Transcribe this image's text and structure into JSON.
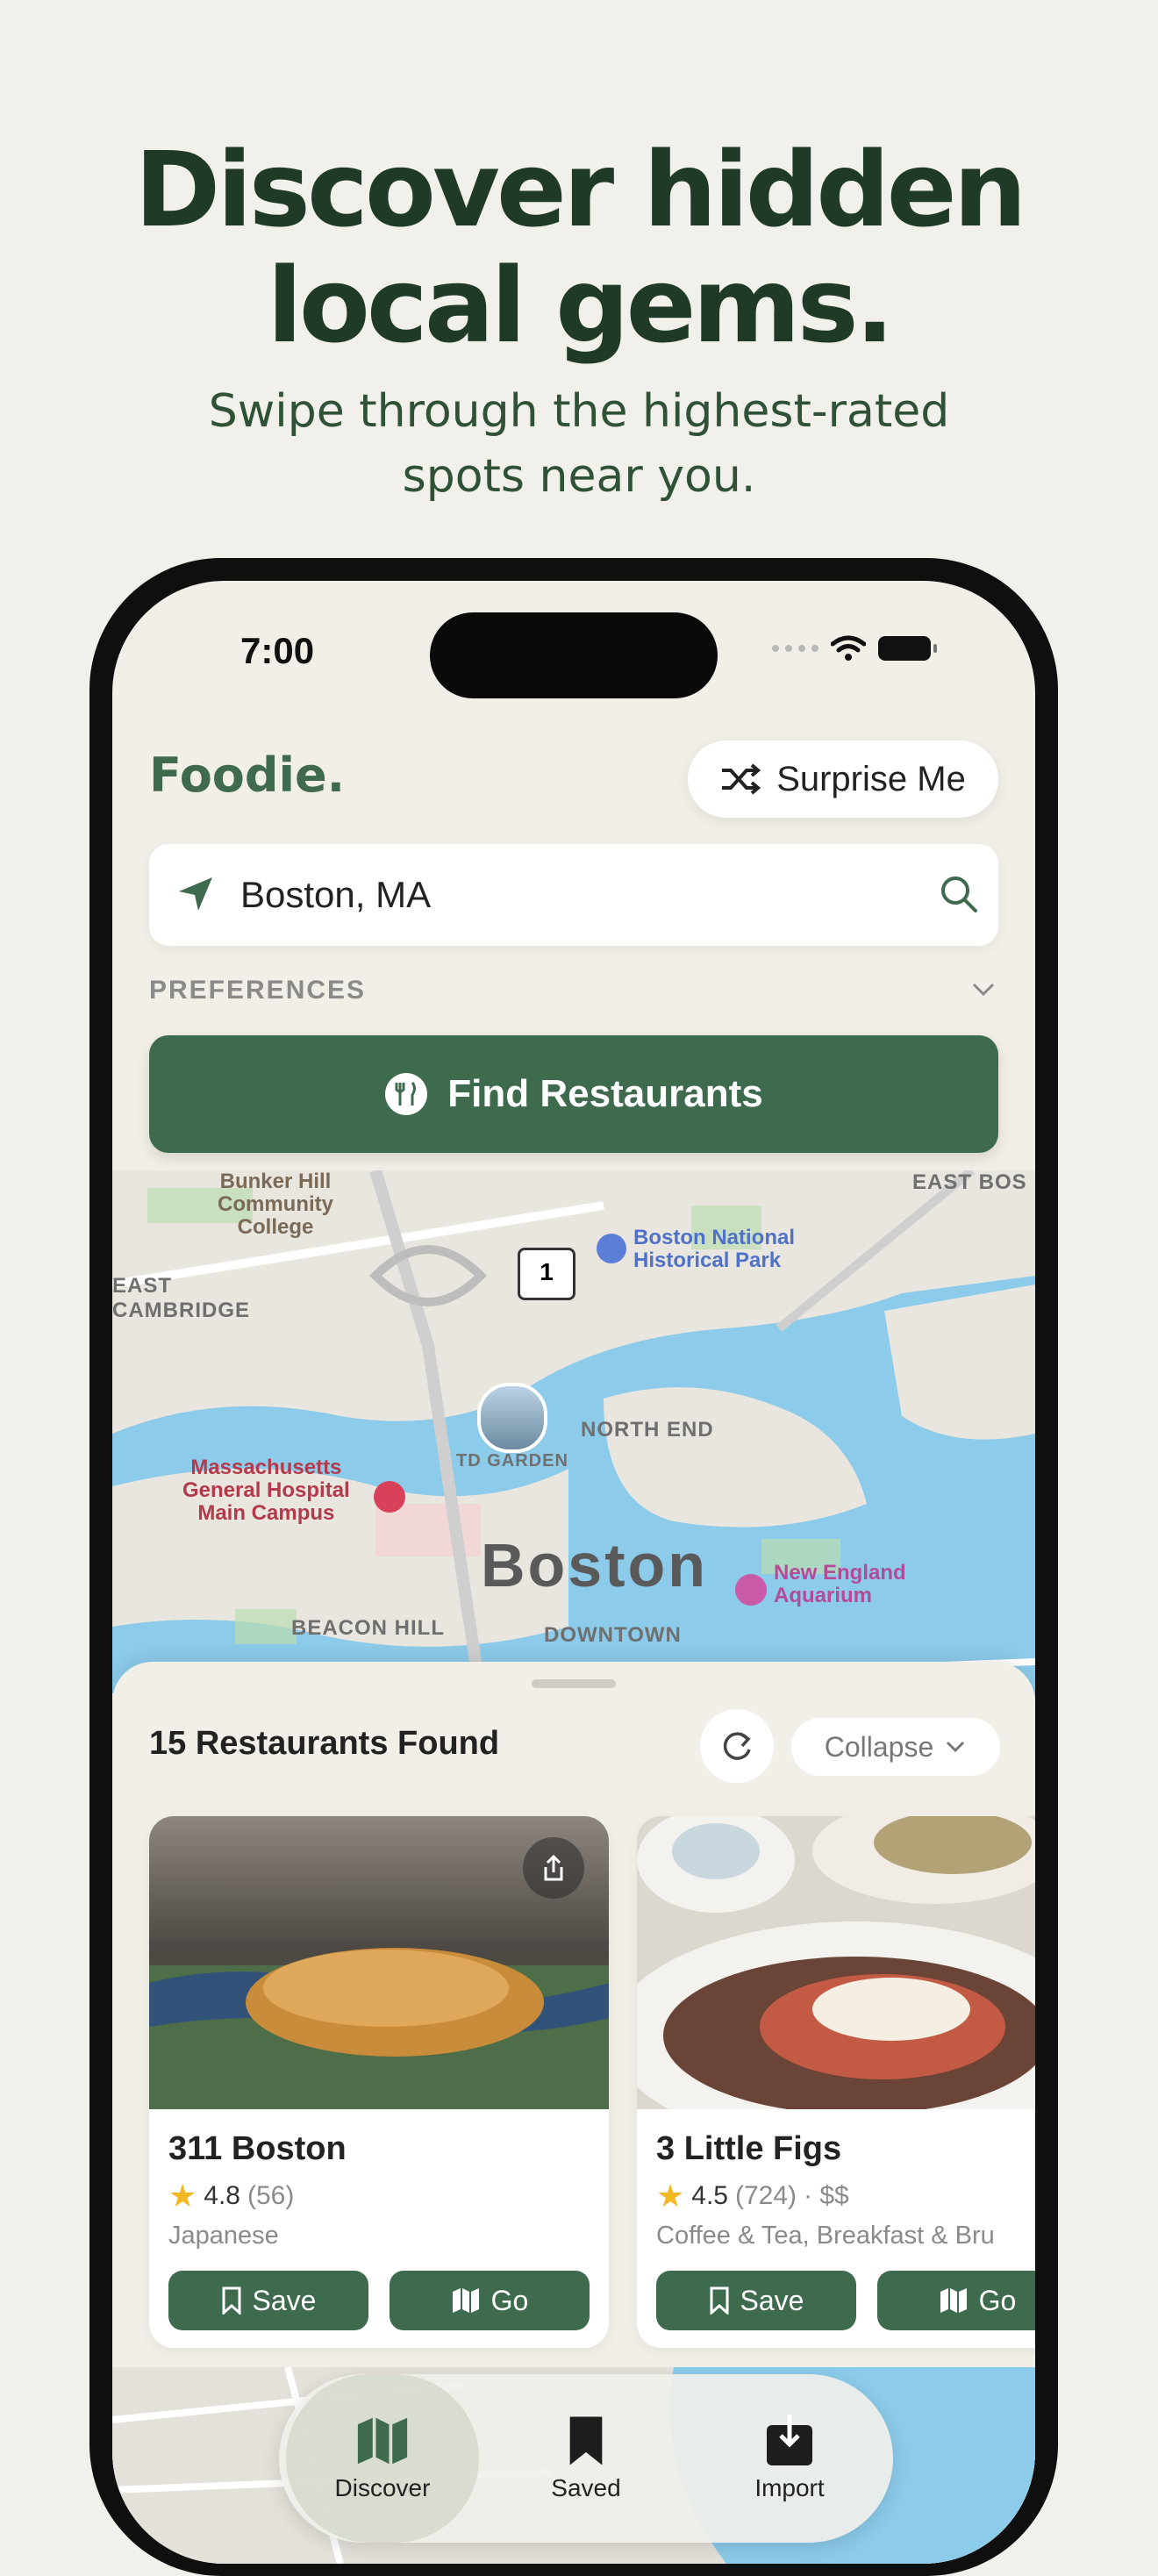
{
  "marketing": {
    "headline_line1": "Discover hidden",
    "headline_line2": "local gems.",
    "subhead_line1": "Swipe through the highest-rated",
    "subhead_line2": "spots near you."
  },
  "status_bar": {
    "time": "7:00"
  },
  "app": {
    "logo": "Foodie.",
    "surprise_label": "Surprise Me",
    "location_value": "Boston, MA",
    "preferences_label": "PREFERENCES",
    "find_label": "Find Restaurants"
  },
  "map": {
    "city": "Boston",
    "labels": {
      "bunker_hill": "Bunker Hill\nCommunity\nCollege",
      "east_cambridge": "EAST\nCAMBRIDGE",
      "east_boston": "EAST BOS",
      "national_park": "Boston National\nHistorical Park",
      "north_end": "NORTH END",
      "td_garden": "TD GARDEN",
      "mgh": "Massachusetts\nGeneral Hospital\nMain Campus",
      "aquarium": "New England\nAquarium",
      "beacon_hill": "BEACON HILL",
      "downtown": "DOWNTOWN",
      "route": "1"
    }
  },
  "results": {
    "count_label": "15 Restaurants Found",
    "collapse_label": "Collapse",
    "cards": [
      {
        "name": "311 Boston",
        "rating": "4.8",
        "reviews": "(56)",
        "price": "",
        "category": "Japanese",
        "save_label": "Save",
        "go_label": "Go"
      },
      {
        "name": "3 Little Figs",
        "rating": "4.5",
        "reviews": "(724)",
        "price": "· $$",
        "category": "Coffee & Tea, Breakfast & Bru",
        "save_label": "Save",
        "go_label": "Go"
      }
    ]
  },
  "tabs": [
    {
      "label": "Discover",
      "icon": "map-icon",
      "active": true
    },
    {
      "label": "Saved",
      "icon": "bookmark-icon",
      "active": false
    },
    {
      "label": "Import",
      "icon": "import-icon",
      "active": false
    }
  ],
  "colors": {
    "brand_green": "#3e6b4d",
    "headline": "#1f3a26",
    "star": "#f2b824"
  }
}
